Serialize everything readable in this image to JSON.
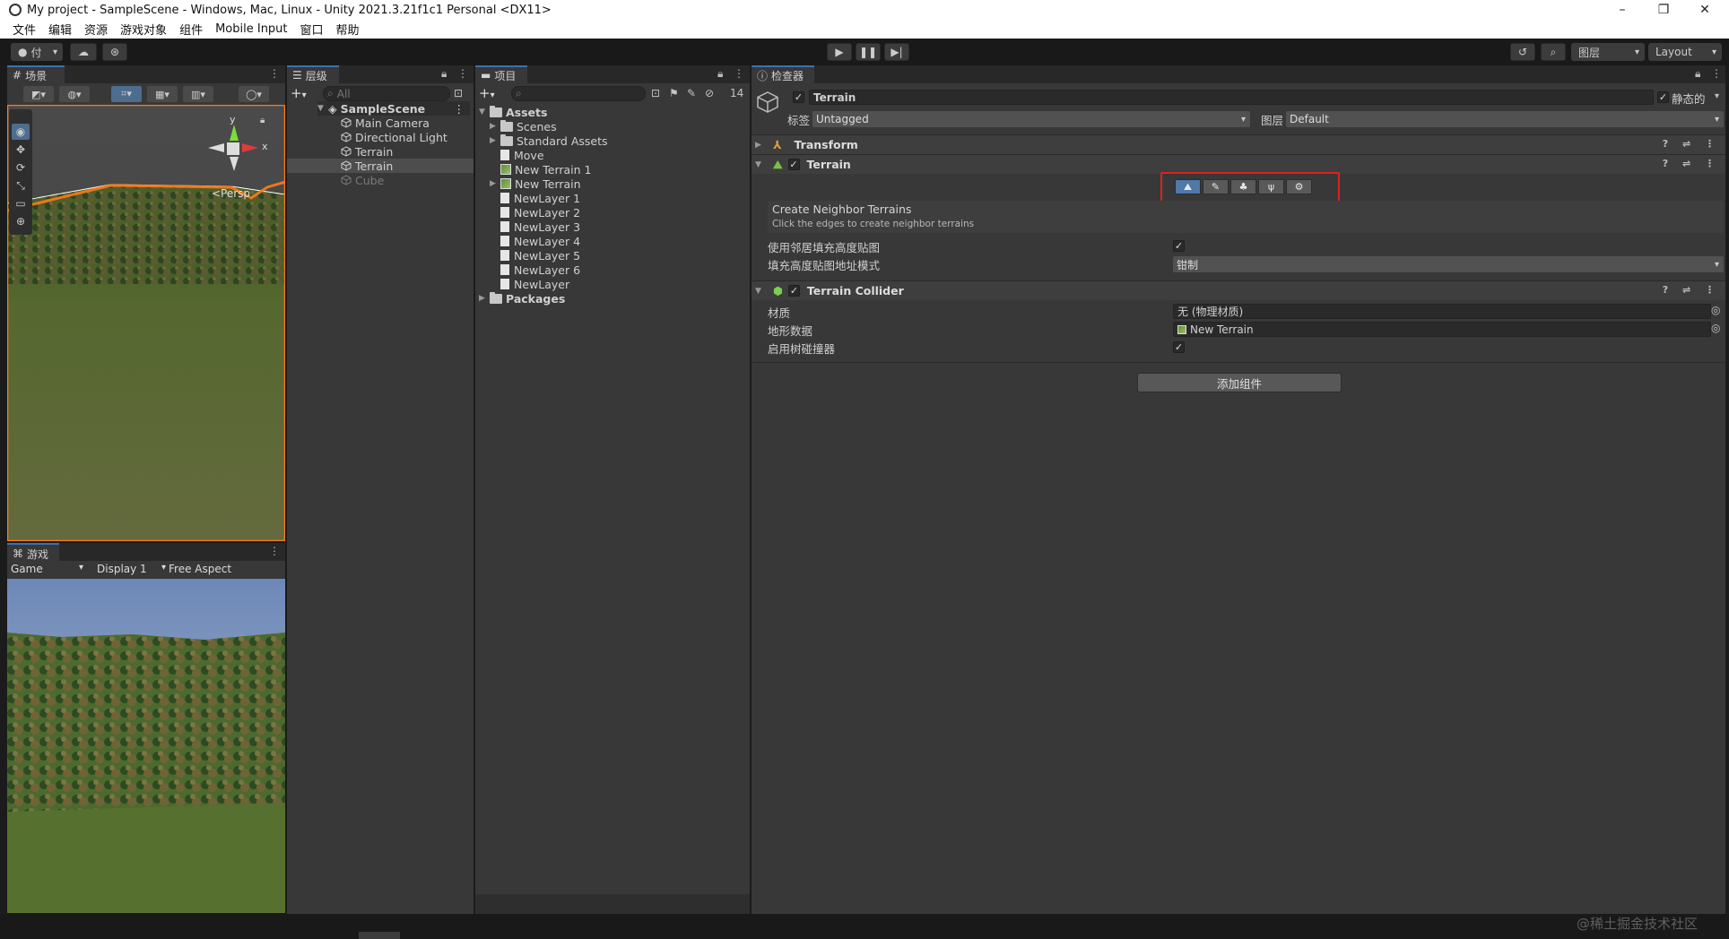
{
  "window": {
    "title": "My project - SampleScene - Windows, Mac, Linux - Unity 2021.3.21f1c1 Personal <DX11>",
    "controls": [
      "–",
      "❐",
      "✕"
    ]
  },
  "menu": [
    "文件",
    "编辑",
    "资源",
    "游戏对象",
    "组件",
    "Mobile Input",
    "窗口",
    "帮助"
  ],
  "toolbar": {
    "account_label": "付",
    "layers_label": "图层",
    "layout_label": "Layout"
  },
  "scene": {
    "tab_label": "场景",
    "persp_label": "<Persp",
    "gizmo_y": "y",
    "gizmo_x": "x"
  },
  "game": {
    "tab_label": "游戏",
    "mode": "Game",
    "display": "Display 1",
    "aspect": "Free Aspect"
  },
  "hierarchy": {
    "tab_label": "层级",
    "search_placeholder": "All",
    "scene_name": "SampleScene",
    "items": [
      "Main Camera",
      "Directional Light",
      "Terrain",
      "Terrain",
      "Cube"
    ]
  },
  "project": {
    "tab_label": "项目",
    "hidden_count": "14",
    "root": "Assets",
    "items": [
      "Scenes",
      "Standard Assets",
      "Move",
      "New Terrain 1",
      "New Terrain",
      "NewLayer 1",
      "NewLayer 2",
      "NewLayer 3",
      "NewLayer 4",
      "NewLayer 5",
      "NewLayer 6",
      "NewLayer"
    ],
    "packages": "Packages"
  },
  "inspector": {
    "tab_label": "检查器",
    "object_name": "Terrain",
    "static_label": "静态的",
    "tag_label": "标签",
    "tag_value": "Untagged",
    "layer_label": "图层",
    "layer_value": "Default",
    "transform_label": "Transform",
    "terrain_label": "Terrain",
    "neighbor_title": "Create Neighbor Terrains",
    "neighbor_hint": "Click the edges to create neighbor terrains",
    "fill_heightmap_label": "使用邻居填充高度贴图",
    "fill_mode_label": "填充高度贴图地址模式",
    "fill_mode_value": "钳制",
    "collider_label": "Terrain Collider",
    "material_label": "材质",
    "material_value": "无 (物理材质)",
    "terrain_data_label": "地形数据",
    "terrain_data_value": "New Terrain",
    "tree_collider_label": "启用树碰撞器",
    "add_component": "添加组件"
  },
  "watermark": "@稀土掘金技术社区",
  "colors": {
    "highlight_box": "#e02020",
    "selection_accent": "#3a72b0",
    "terrain_edge": "#ff7a1a"
  }
}
